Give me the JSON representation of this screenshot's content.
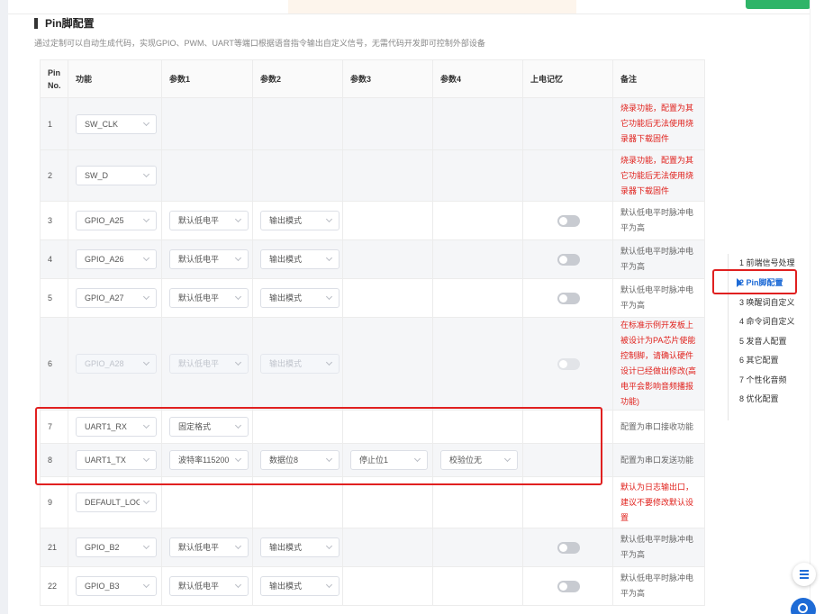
{
  "section": {
    "title": "Pin脚配置",
    "description": "通过定制可以自动生成代码，实现GPIO、PWM、UART等端口根据语音指令输出自定义信号，无需代码开发即可控制外部设备"
  },
  "table": {
    "headers": {
      "pin": "Pin No.",
      "function": "功能",
      "param1": "参数1",
      "param2": "参数2",
      "param3": "参数3",
      "param4": "参数4",
      "power_memory": "上电记忆",
      "remark": "备注"
    },
    "rows": [
      {
        "pin": "1",
        "function": "SW_CLK",
        "remark": "烧录功能，配置为其它功能后无法使用烧录器下载固件"
      },
      {
        "pin": "2",
        "function": "SW_D",
        "remark": "烧录功能，配置为其它功能后无法使用烧录器下载固件"
      },
      {
        "pin": "3",
        "function": "GPIO_A25",
        "param1": "默认低电平",
        "param2": "输出模式",
        "remark": "默认低电平时脉冲电平为高"
      },
      {
        "pin": "4",
        "function": "GPIO_A26",
        "param1": "默认低电平",
        "param2": "输出模式",
        "remark": "默认低电平时脉冲电平为高"
      },
      {
        "pin": "5",
        "function": "GPIO_A27",
        "param1": "默认低电平",
        "param2": "输出模式",
        "remark": "默认低电平时脉冲电平为高"
      },
      {
        "pin": "6",
        "function": "GPIO_A28",
        "param1": "默认低电平",
        "param2": "输出模式",
        "remark": "在标准示例开发板上被设计为PA芯片使能控制脚，请确认硬件设计已经做出修改(高电平会影响音频播报功能)"
      },
      {
        "pin": "7",
        "function": "UART1_RX",
        "param1": "固定格式",
        "remark": "配置为串口接收功能"
      },
      {
        "pin": "8",
        "function": "UART1_TX",
        "param1": "波特率115200",
        "param2": "数据位8",
        "param3": "停止位1",
        "param4": "校验位无",
        "remark": "配置为串口发送功能"
      },
      {
        "pin": "9",
        "function": "DEFAULT_LOG",
        "remark": "默认为日志输出口，建议不要修改默认设置"
      },
      {
        "pin": "21",
        "function": "GPIO_B2",
        "param1": "默认低电平",
        "param2": "输出模式",
        "remark": "默认低电平时脉冲电平为高"
      },
      {
        "pin": "22",
        "function": "GPIO_B3",
        "param1": "默认低电平",
        "param2": "输出模式",
        "remark": "默认低电平时脉冲电平为高"
      }
    ]
  },
  "toc": {
    "items": [
      {
        "label": "1  前端信号处理"
      },
      {
        "label": "2  Pin脚配置"
      },
      {
        "label": "3  唤醒词自定义"
      },
      {
        "label": "4  命令词自定义"
      },
      {
        "label": "5  发音人配置"
      },
      {
        "label": "6  其它配置"
      },
      {
        "label": "7  个性化音频"
      },
      {
        "label": "8  优化配置"
      }
    ],
    "active_index": 1
  },
  "colors": {
    "accent": "#1e6bd6",
    "warning_text": "#e0201b",
    "highlight_box": "#e02020",
    "top_green": "#2fb468"
  },
  "icons": {
    "menu": "hamburger-menu-icon",
    "help": "help-circle-icon",
    "dropdown": "chevron-down-icon",
    "toc_marker": "caret-right-icon"
  }
}
